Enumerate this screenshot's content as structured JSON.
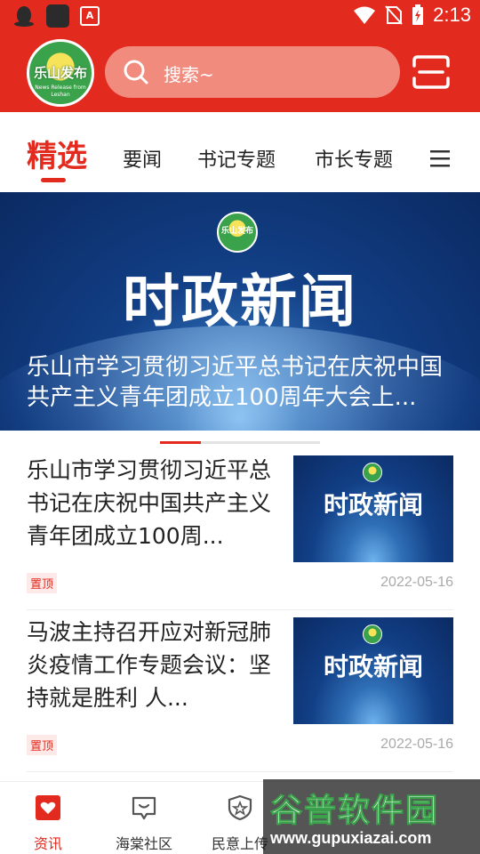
{
  "status_bar": {
    "time": "2:13"
  },
  "header": {
    "logo_text": "乐山发布",
    "logo_subtext": "News Release from Leshan",
    "search_placeholder": "搜索~"
  },
  "tabs": [
    {
      "label": "精选",
      "active": true
    },
    {
      "label": "要闻"
    },
    {
      "label": "书记专题"
    },
    {
      "label": "市长专题"
    }
  ],
  "banner": {
    "logo_text": "乐山发布",
    "headline": "时政新闻",
    "caption": "乐山市学习贯彻习近平总书记在庆祝中国共产主义青年团成立100周年大会上..."
  },
  "news": [
    {
      "title": "乐山市学习贯彻习近平总书记在庆祝中国共产主义青年团成立100周...",
      "thumb_text": "时政新闻",
      "badge": "置顶",
      "date": "2022-05-16"
    },
    {
      "title": "马波主持召开应对新冠肺炎疫情工作专题会议：坚持就是胜利 人...",
      "thumb_text": "时政新闻",
      "badge": "置顶",
      "date": "2022-05-16"
    }
  ],
  "bottom_nav": [
    {
      "label": "资讯",
      "icon": "heart-icon",
      "active": true
    },
    {
      "label": "海棠社区",
      "icon": "community-icon"
    },
    {
      "label": "民意上传",
      "icon": "shield-star-icon"
    }
  ],
  "watermark": {
    "line1": "谷普软件园",
    "line2": "www.gupuxiazai.com"
  },
  "colors": {
    "brand_red": "#e32a1f",
    "search_bg": "#f08b7e",
    "badge_bg": "#fde9e7",
    "date_gray": "#aaaaaa"
  }
}
